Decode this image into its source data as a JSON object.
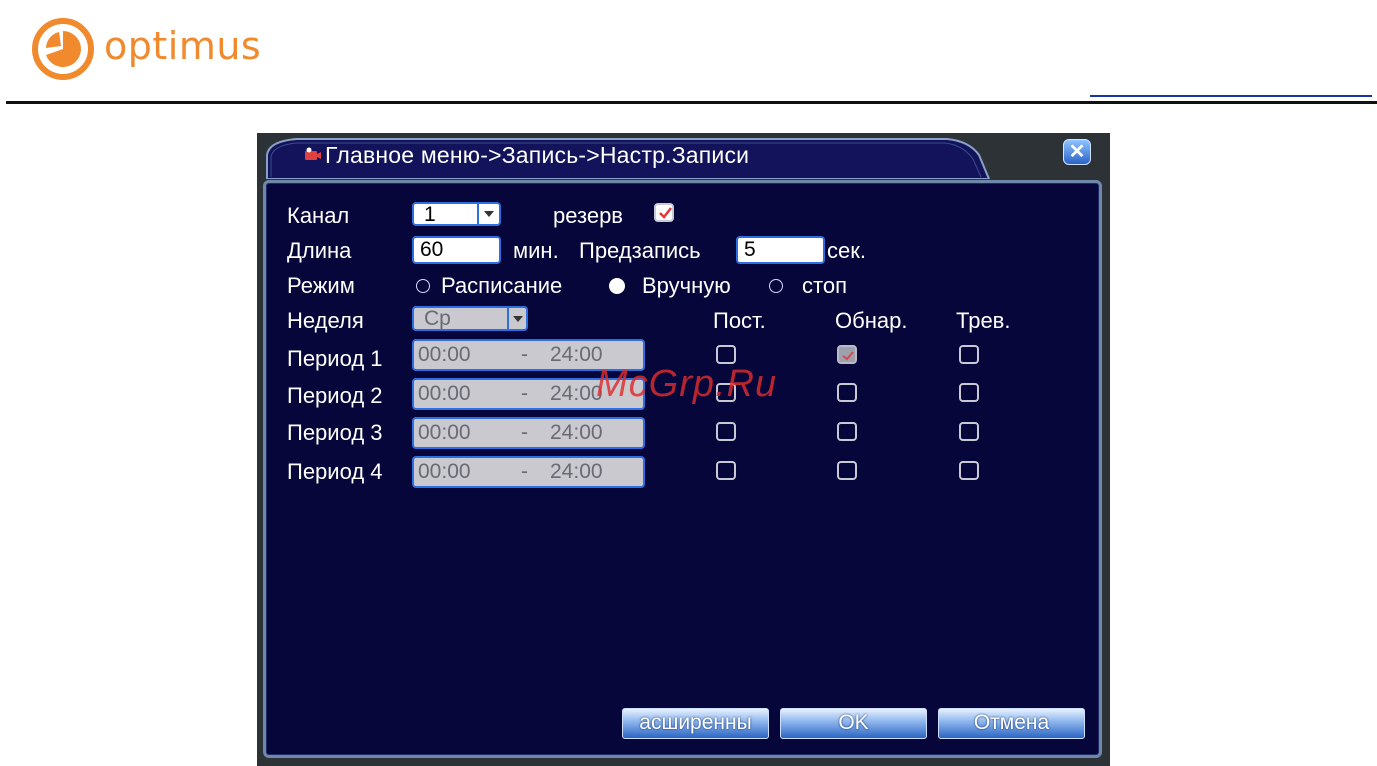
{
  "brand": {
    "name": "optimus",
    "color": "#f08a2c"
  },
  "watermark": "McGrp.Ru",
  "window": {
    "title": "Главное меню->Запись->Настр.Записи",
    "close_icon": "close-icon"
  },
  "form": {
    "channel_label": "Канал",
    "channel_value": "1",
    "redundant_label": "резерв",
    "length_label": "Длина",
    "length_value": "60",
    "length_unit": "мин.",
    "prerecord_label": "Предзапись",
    "prerecord_value": "5",
    "prerecord_unit": "сек.",
    "mode_label": "Режим",
    "mode_options": [
      "Расписание",
      "Вручную",
      "стоп"
    ],
    "mode_selected": "Вручную",
    "week_label": "Неделя",
    "week_value": "Ср",
    "col_headers": [
      "Пост.",
      "Обнар.",
      "Трев."
    ],
    "periods": [
      {
        "label": "Период 1",
        "start": "00:00",
        "sep": "-",
        "end": "24:00",
        "checks": [
          false,
          true,
          false
        ]
      },
      {
        "label": "Период 2",
        "start": "00:00",
        "sep": "-",
        "end": "24:00",
        "checks": [
          false,
          false,
          false
        ]
      },
      {
        "label": "Период 3",
        "start": "00:00",
        "sep": "-",
        "end": "24:00",
        "checks": [
          false,
          false,
          false
        ]
      },
      {
        "label": "Период 4",
        "start": "00:00",
        "sep": "-",
        "end": "24:00",
        "checks": [
          false,
          false,
          false
        ]
      }
    ]
  },
  "buttons": {
    "advanced": "асширенны",
    "ok": "OK",
    "cancel": "Отмена"
  }
}
